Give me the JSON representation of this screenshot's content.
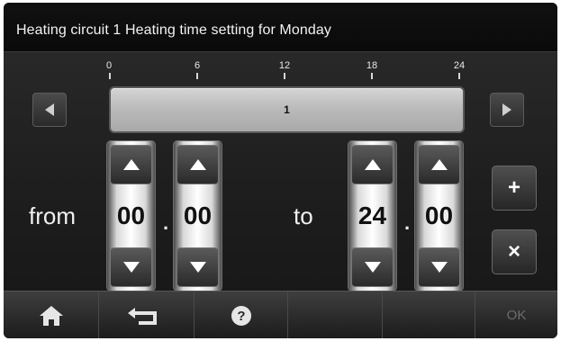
{
  "title": "Heating circuit 1 Heating time setting for Monday",
  "scale": {
    "labels": [
      "0",
      "6",
      "12",
      "18",
      "24"
    ]
  },
  "timeline": {
    "period_label": "1"
  },
  "from": {
    "label": "from",
    "hours": "00",
    "minutes": "00",
    "separator": "."
  },
  "to": {
    "label": "to",
    "hours": "24",
    "minutes": "00",
    "separator": "."
  },
  "nav": {
    "prev_icon": "triangle-left-icon",
    "next_icon": "triangle-right-icon"
  },
  "actions": {
    "add_label": "+",
    "delete_label": "×"
  },
  "footer": {
    "home_icon": "home-icon",
    "back_icon": "back-arrow-icon",
    "help_icon": "help-icon",
    "ok_label": "OK"
  }
}
